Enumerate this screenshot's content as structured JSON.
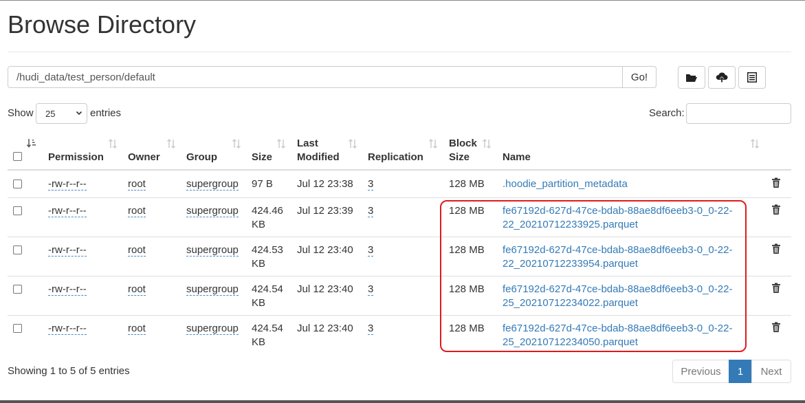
{
  "page": {
    "title": "Browse Directory"
  },
  "path_bar": {
    "value": "/hudi_data/test_person/default",
    "go_label": "Go!"
  },
  "toolbar": {
    "icons": [
      "folder-open-icon",
      "cloud-upload-icon",
      "list-icon"
    ]
  },
  "length_control": {
    "show_label": "Show",
    "selected": "25",
    "entries_label": "entries"
  },
  "search": {
    "label": "Search:",
    "value": ""
  },
  "table": {
    "headers": {
      "permission": "Permission",
      "owner": "Owner",
      "group": "Group",
      "size": "Size",
      "last_modified_1": "Last",
      "last_modified_2": "Modified",
      "replication": "Replication",
      "block_size_1": "Block",
      "block_size_2": "Size",
      "name": "Name"
    },
    "rows": [
      {
        "permission": "-rw-r--r--",
        "owner": "root",
        "group": "supergroup",
        "size_1": "97 B",
        "size_2": "",
        "modified": "Jul 12 23:38",
        "replication": "3",
        "block_size": "128 MB",
        "name_1": ".hoodie_partition_metadata",
        "name_2": ""
      },
      {
        "permission": "-rw-r--r--",
        "owner": "root",
        "group": "supergroup",
        "size_1": "424.46",
        "size_2": "KB",
        "modified": "Jul 12 23:39",
        "replication": "3",
        "block_size": "128 MB",
        "name_1": "fe67192d-627d-47ce-bdab-88ae8df6eeb3-0_0-22-",
        "name_2": "22_20210712233925.parquet"
      },
      {
        "permission": "-rw-r--r--",
        "owner": "root",
        "group": "supergroup",
        "size_1": "424.53",
        "size_2": "KB",
        "modified": "Jul 12 23:40",
        "replication": "3",
        "block_size": "128 MB",
        "name_1": "fe67192d-627d-47ce-bdab-88ae8df6eeb3-0_0-22-",
        "name_2": "22_20210712233954.parquet"
      },
      {
        "permission": "-rw-r--r--",
        "owner": "root",
        "group": "supergroup",
        "size_1": "424.54",
        "size_2": "KB",
        "modified": "Jul 12 23:40",
        "replication": "3",
        "block_size": "128 MB",
        "name_1": "fe67192d-627d-47ce-bdab-88ae8df6eeb3-0_0-22-",
        "name_2": "25_20210712234022.parquet"
      },
      {
        "permission": "-rw-r--r--",
        "owner": "root",
        "group": "supergroup",
        "size_1": "424.54",
        "size_2": "KB",
        "modified": "Jul 12 23:40",
        "replication": "3",
        "block_size": "128 MB",
        "name_1": "fe67192d-627d-47ce-bdab-88ae8df6eeb3-0_0-22-",
        "name_2": "25_20210712234050.parquet"
      }
    ]
  },
  "footer": {
    "info": "Showing 1 to 5 of 5 entries",
    "previous": "Previous",
    "page": "1",
    "next": "Next"
  },
  "colors": {
    "link": "#337ab7",
    "active_page": "#337ab7",
    "highlight": "#e0191c"
  }
}
